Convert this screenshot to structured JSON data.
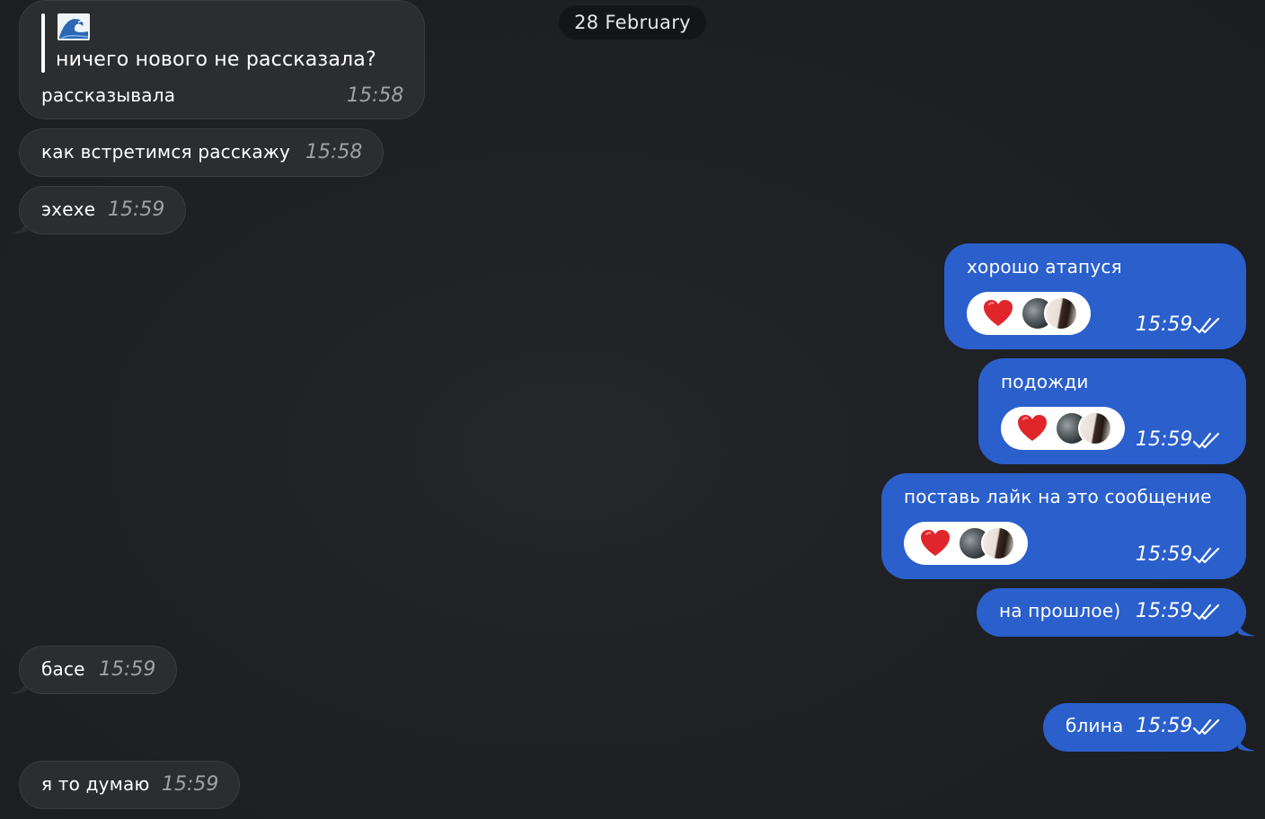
{
  "date_label": "28 February",
  "incoming": {
    "m1": {
      "quote_emoji": "wave-emoji",
      "quote_text": "ничего нового не рассказала?",
      "text": "рассказывала",
      "time": "15:58"
    },
    "m2": {
      "text": "как встретимся расскажу",
      "time": "15:58"
    },
    "m3": {
      "text": "эхехе",
      "time": "15:59"
    },
    "m4": {
      "text": "басе",
      "time": "15:59"
    },
    "m5": {
      "text": "я то думаю",
      "time": "15:59"
    }
  },
  "outgoing": {
    "m1": {
      "text": "хорошо атапуся",
      "time": "15:59",
      "reaction": "heart",
      "status": "read"
    },
    "m2": {
      "text": "подожди",
      "time": "15:59",
      "reaction": "heart",
      "status": "read"
    },
    "m3": {
      "text": "поставь лайк на это сообщение",
      "time": "15:59",
      "reaction": "heart",
      "status": "read"
    },
    "m4": {
      "text": "на прошлое)",
      "time": "15:59",
      "status": "read"
    },
    "m5": {
      "text": "блина",
      "time": "15:59",
      "status": "read"
    }
  },
  "colors": {
    "background": "#1d1f22",
    "incoming_bubble": "#2c2d2f",
    "outgoing_bubble": "#2a5fcc",
    "date_pill": "#141517",
    "reaction_heart": "#e0262b"
  }
}
